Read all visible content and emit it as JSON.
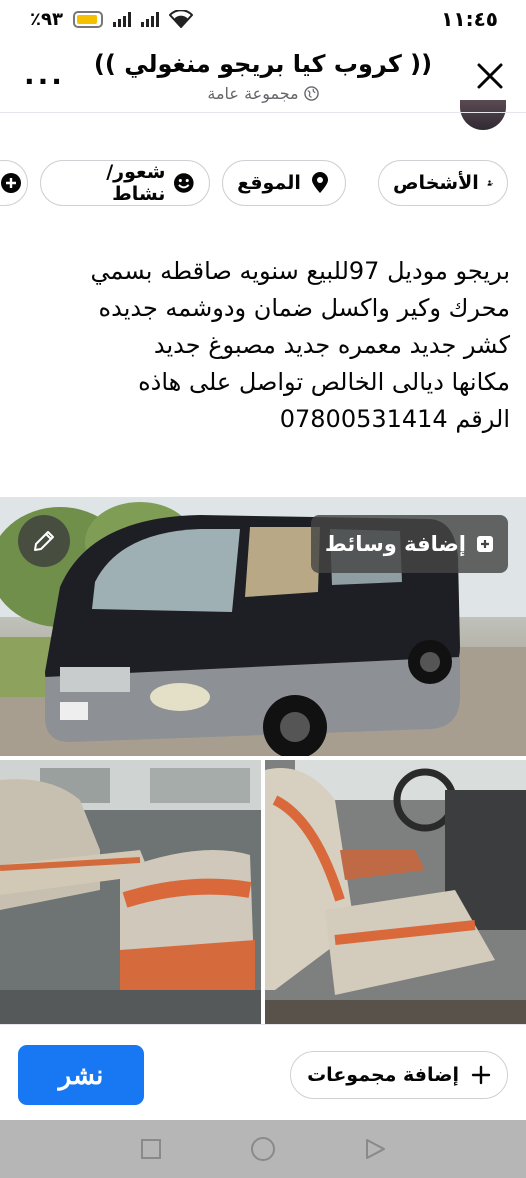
{
  "status_bar": {
    "battery_percent": "٪٩٣",
    "battery_level": 0.93,
    "time": "١١:٤٥"
  },
  "header": {
    "title": "(( كروب كيا بريجو منغولي ))",
    "subtitle": "مجموعة عامة",
    "more_label": "...",
    "icons": [
      "more-icon",
      "globe-icon",
      "close-icon"
    ]
  },
  "chips": [
    {
      "label": "الأشخاص",
      "icon": "people-icon"
    },
    {
      "label": "الموقع",
      "icon": "location-pin-icon"
    },
    {
      "label": "شعور/نشاط",
      "icon": "smiley-icon"
    },
    {
      "label": "",
      "icon": "add-icon"
    }
  ],
  "post": {
    "lines": [
      "بريجو موديل 97للبيع سنويه صاقطه بسمي",
      "محرك وكير واكسل ضمان ودوشمه جديده",
      "كشر جديد معمره جديد مصبوغ جديد",
      "مكانها ديالى الخالص  تواصل على هاذه",
      "الرقم 07800531414"
    ]
  },
  "media": {
    "add_media_label": "إضافة وسائط",
    "icons": [
      "edit-pencil-icon",
      "add-media-icon"
    ]
  },
  "actions": {
    "publish_label": "نشر",
    "add_groups_label": "إضافة مجموعات",
    "publish_color": "#1877f2"
  },
  "nav": {
    "buttons": [
      "recent-apps-icon",
      "home-icon",
      "back-icon"
    ]
  }
}
